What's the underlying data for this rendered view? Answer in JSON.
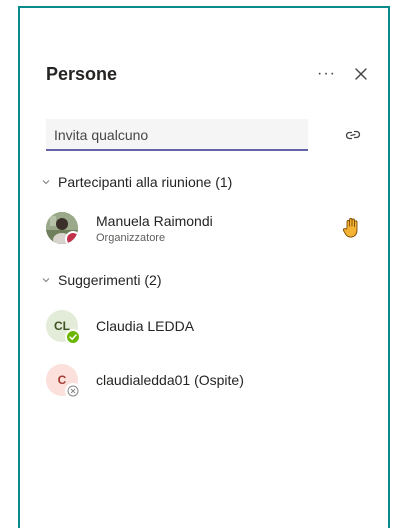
{
  "panel": {
    "title": "Persone"
  },
  "header": {
    "more_label": "···",
    "more_icon": "more-options-icon",
    "close_icon": "close-icon"
  },
  "invite": {
    "placeholder": "Invita qualcuno",
    "link_icon": "copy-link-icon"
  },
  "sections": {
    "participants": {
      "label": "Partecipanti alla riunione (1)",
      "people": [
        {
          "name": "Manuela Raimondi",
          "role": "Organizzatore",
          "presence": "busy",
          "hand_raised": true
        }
      ]
    },
    "suggestions": {
      "label": "Suggerimenti (2)",
      "people": [
        {
          "name": "Claudia LEDDA",
          "initials": "CL",
          "presence": "available"
        },
        {
          "name": "claudialedda01 (Ospite)",
          "initials": "C",
          "presence": "unknown"
        }
      ]
    }
  },
  "colors": {
    "frame": "#0b8a8a",
    "accent": "#6264a7",
    "busy": "#c4314b",
    "available": "#6bb700",
    "hand": "#f5b335"
  }
}
